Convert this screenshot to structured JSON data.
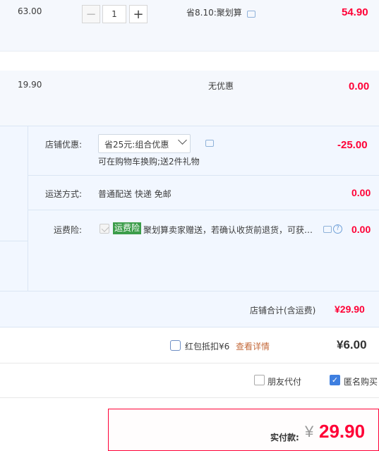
{
  "items": [
    {
      "price": "63.00",
      "quantity": "1",
      "discount_text": "省8.10:聚划算",
      "total": "54.90"
    },
    {
      "price": "19.90",
      "discount_text": "无优惠",
      "total": "0.00"
    }
  ],
  "shop": {
    "discount_label": "店铺优惠:",
    "discount_select": "省25元:组合优惠",
    "discount_note": "可在购物车换购;送2件礼物",
    "discount_amount": "-25.00",
    "shipping_label": "运送方式:",
    "shipping_value": "普通配送 快递 免邮",
    "shipping_amount": "0.00",
    "insurance_label": "运费险:",
    "insurance_tag": "运费险",
    "insurance_desc": "聚划算卖家赠送，若确认收货前退货，可获…",
    "insurance_amount": "0.00",
    "total_label": "店铺合计(含运费)",
    "total_value": "¥29.90"
  },
  "redpacket": {
    "label": "红包抵扣¥6",
    "details_link": "查看详情",
    "amount": "¥6.00"
  },
  "options": {
    "friend_pay": "朋友代付",
    "anonymous": "匿名购买"
  },
  "payment": {
    "label": "实付款:",
    "currency": "¥",
    "amount": "29.90"
  },
  "colors": {
    "price_red": "#ff0036",
    "accent_blue": "#3e7fe0",
    "insurance_green": "#3c9d4a"
  }
}
